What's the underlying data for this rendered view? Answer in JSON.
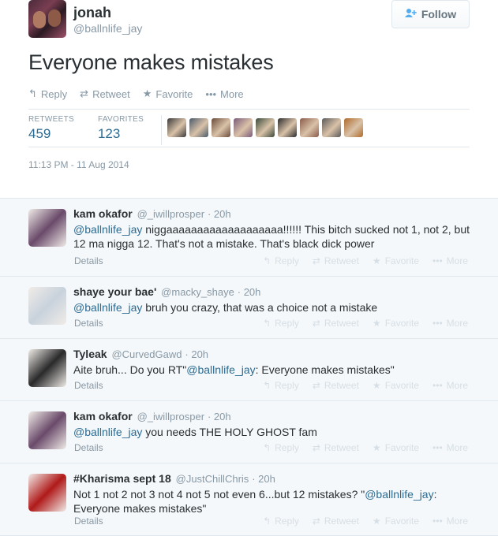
{
  "author": {
    "name": "jonah",
    "handle": "@ballnlife_jay"
  },
  "follow_button": {
    "label": "Follow",
    "icon": "add-user-icon"
  },
  "tweet": {
    "text": "Everyone makes mistakes",
    "timestamp": "11:13 PM - 11 Aug 2014"
  },
  "actions": [
    {
      "label": "Reply",
      "icon": "reply-icon"
    },
    {
      "label": "Retweet",
      "icon": "retweet-icon"
    },
    {
      "label": "Favorite",
      "icon": "star-icon"
    },
    {
      "label": "More",
      "icon": "more-icon"
    }
  ],
  "stats": {
    "retweets_label": "RETWEETS",
    "retweets_value": "459",
    "favorites_label": "FAVORITES",
    "favorites_value": "123"
  },
  "favoriter_colors": [
    "#3b3b3b",
    "#4a5a6a",
    "#6b4b3b",
    "#7a5a7a",
    "#3a4a3a",
    "#2b2b2b",
    "#8a5a4a",
    "#5a5a5a",
    "#b06a2a"
  ],
  "replies": [
    {
      "name": "kam okafor",
      "handle": "@_iwillprosper",
      "time": "· 20h",
      "mention": "@ballnlife_jay",
      "text": " niggaaaaaaaaaaaaaaaaaaa!!!!!! This bitch sucked not 1, not 2, but 12 ma nigga 12. That's not a mistake. That's black dick power",
      "details": "Details",
      "avatar_color": "#6a4a6a"
    },
    {
      "name": "shaye your bae'",
      "handle": "@macky_shaye",
      "time": "· 20h",
      "mention": "@ballnlife_jay",
      "text": " bruh you crazy, that was a choice not a mistake",
      "details": "Details",
      "avatar_color": "#c8d2dc"
    },
    {
      "name": "Tyleak",
      "handle": "@CurvedGawd",
      "time": "· 20h",
      "text_pre": "Aite bruh... Do you RT\"",
      "mention": "@ballnlife_jay",
      "text": ": Everyone makes mistakes\"",
      "details": "Details",
      "avatar_color": "#2a2a2a"
    },
    {
      "name": "kam okafor",
      "handle": "@_iwillprosper",
      "time": "· 20h",
      "mention": "@ballnlife_jay",
      "text": " you needs THE HOLY GHOST fam",
      "details": "Details",
      "avatar_color": "#6a4a6a"
    },
    {
      "name": "#Kharisma sept 18",
      "handle": "@JustChillChris",
      "time": "· 20h",
      "text_pre": "Not 1 not 2 not 3 not 4 not 5 not even 6...but 12 mistakes? \"",
      "mention": "@ballnlife_jay",
      "text": ": Everyone makes mistakes\"",
      "details": "Details",
      "avatar_color": "#b01a1a"
    }
  ],
  "reply_actions": [
    {
      "label": "Reply",
      "icon": "reply-icon"
    },
    {
      "label": "Retweet",
      "icon": "retweet-icon"
    },
    {
      "label": "Favorite",
      "icon": "star-icon"
    },
    {
      "label": "More",
      "icon": "more-icon"
    }
  ]
}
